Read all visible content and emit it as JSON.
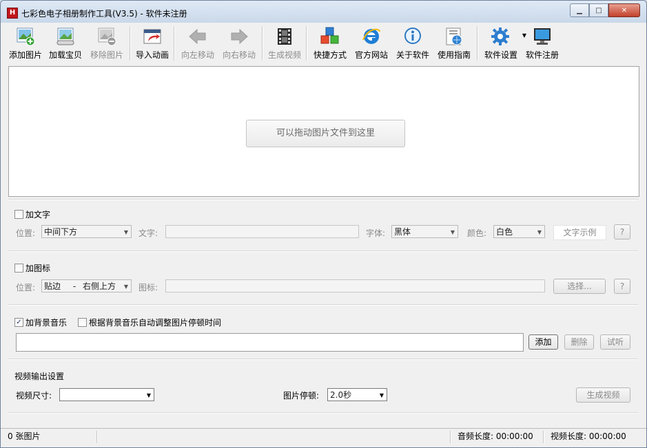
{
  "window": {
    "title": "七彩色电子相册制作工具(V3.5) - 软件未注册",
    "app_icon_letter": "H",
    "min_glyph": "▁",
    "max_glyph": "□",
    "close_glyph": "✕"
  },
  "toolbar": {
    "items": [
      {
        "label": "添加图片",
        "icon": "add-image-icon",
        "enabled": true
      },
      {
        "label": "加载宝贝",
        "icon": "load-items-icon",
        "enabled": true
      },
      {
        "label": "移除图片",
        "icon": "remove-image-icon",
        "enabled": false
      },
      {
        "label": "导入动画",
        "icon": "import-animation-icon",
        "enabled": true
      },
      {
        "label": "向左移动",
        "icon": "arrow-left-icon",
        "enabled": false
      },
      {
        "label": "向右移动",
        "icon": "arrow-right-icon",
        "enabled": false
      },
      {
        "label": "生成视频",
        "icon": "film-icon",
        "enabled": false
      },
      {
        "label": "快捷方式",
        "icon": "shortcut-cubes-icon",
        "enabled": true
      },
      {
        "label": "官方网站",
        "icon": "ie-icon",
        "enabled": true
      },
      {
        "label": "关于软件",
        "icon": "info-icon",
        "enabled": true
      },
      {
        "label": "使用指南",
        "icon": "guide-icon",
        "enabled": true
      },
      {
        "label": "软件设置",
        "icon": "gear-icon",
        "enabled": true
      },
      {
        "label": "软件注册",
        "icon": "monitor-icon",
        "enabled": true
      }
    ]
  },
  "drop_area": {
    "button_label": "可以拖动图片文件到这里"
  },
  "text_section": {
    "checkbox_label": "加文字",
    "checked": false,
    "position_label": "位置:",
    "position_value": "中间下方",
    "text_label": "文字:",
    "text_value": "",
    "font_label": "字体:",
    "font_value": "黑体",
    "color_label": "颜色:",
    "color_value": "白色",
    "sample_label": "文字示例",
    "help_label": "?"
  },
  "logo_section": {
    "checkbox_label": "加图标",
    "checked": false,
    "position_label": "位置:",
    "position_value_a": "贴边",
    "position_value_sep": "-",
    "position_value_b": "右侧上方",
    "icon_label": "图标:",
    "icon_value": "",
    "select_label": "选择...",
    "help_label": "?"
  },
  "music_section": {
    "bg_music_label": "加背景音乐",
    "bg_music_checked": true,
    "auto_adjust_label": "根据背景音乐自动调整图片停顿时间",
    "auto_adjust_checked": false,
    "music_path": "",
    "add_label": "添加",
    "delete_label": "删除",
    "preview_label": "试听",
    "check_glyph": "✓"
  },
  "video_section": {
    "heading": "视频输出设置",
    "size_label": "视频尺寸:",
    "size_value": "",
    "pause_label": "图片停顿:",
    "pause_value": "2.0秒",
    "generate_label": "生成视频"
  },
  "status_bar": {
    "image_count": "0 张图片",
    "audio_length": "音频长度: 00:00:00",
    "video_length": "视频长度: 00:00:00"
  }
}
